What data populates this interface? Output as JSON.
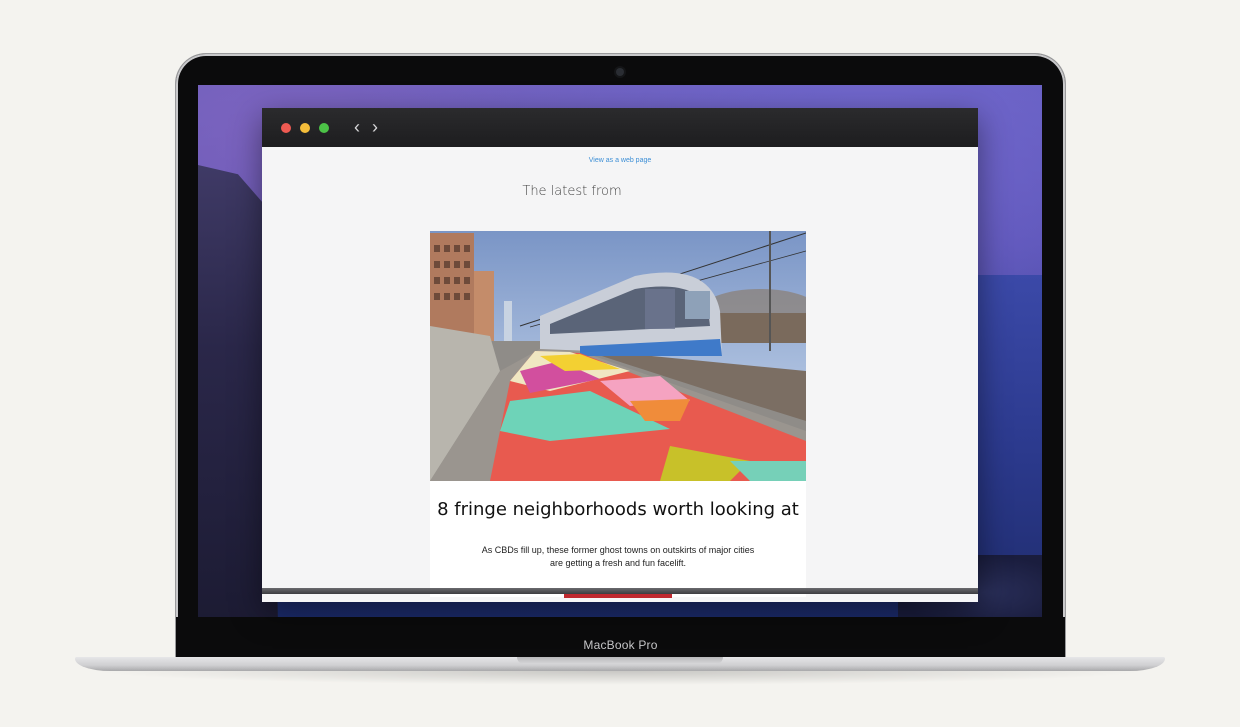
{
  "device": {
    "model_label": "MacBook Pro"
  },
  "browser": {
    "nav": {
      "back_icon": "‹",
      "forward_icon": "›"
    }
  },
  "email": {
    "web_link": "View as a web page",
    "intro": "The latest from",
    "article": {
      "headline": "8 fringe neighborhoods worth looking at",
      "summary": "As CBDs fill up, these former ghost towns on outskirts of major cities are getting a fresh and fun facelift."
    }
  },
  "colors": {
    "link": "#3d8fd6",
    "cta": "#c0282f",
    "traffic_red": "#ee5a52",
    "traffic_yellow": "#f4bd3a",
    "traffic_green": "#4cc247"
  }
}
